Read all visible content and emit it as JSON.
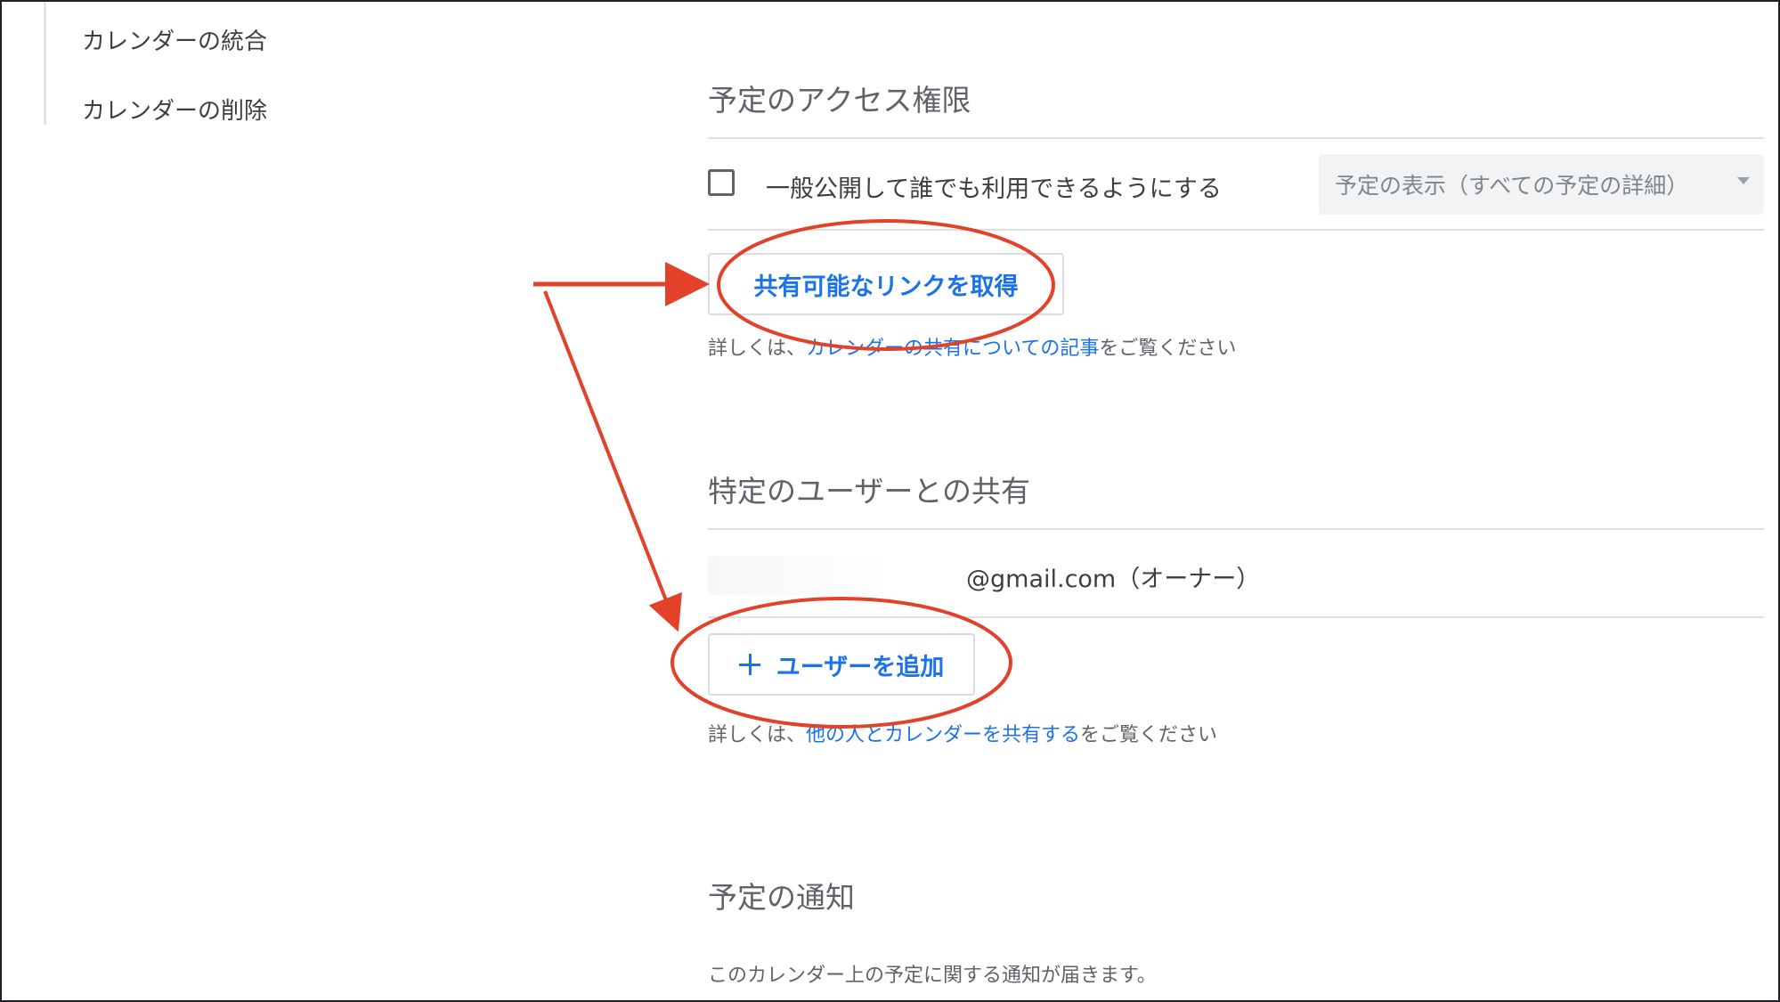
{
  "sidebar": {
    "items": [
      {
        "label": "カレンダーの統合"
      },
      {
        "label": "カレンダーの削除"
      }
    ]
  },
  "access": {
    "title": "予定のアクセス権限",
    "public_label": "一般公開して誰でも利用できるようにする",
    "public_checked": false,
    "visibility_select": "予定の表示（すべての予定の詳細）",
    "get_link_button": "共有可能なリンクを取得",
    "help_prefix": "詳しくは、",
    "help_link": "カレンダーの共有についての記事",
    "help_suffix": "をご覧ください"
  },
  "sharing": {
    "title": "特定のユーザーとの共有",
    "owner_email": "@gmail.com（オーナー）",
    "add_user_button": "ユーザーを追加",
    "help_prefix": "詳しくは、",
    "help_link": "他の人とカレンダーを共有する",
    "help_suffix": "をご覧ください"
  },
  "notifications": {
    "title": "予定の通知",
    "description": "このカレンダー上の予定に関する通知が届きます。"
  },
  "colors": {
    "accent": "#1a73e8",
    "annotation": "#e2412a",
    "text": "#3c4043",
    "muted": "#5f6368",
    "select_bg": "#f1f3f4"
  },
  "icons": {
    "checkbox": "checkbox-icon",
    "dropdown": "chevron-down-icon",
    "add": "plus-icon"
  }
}
